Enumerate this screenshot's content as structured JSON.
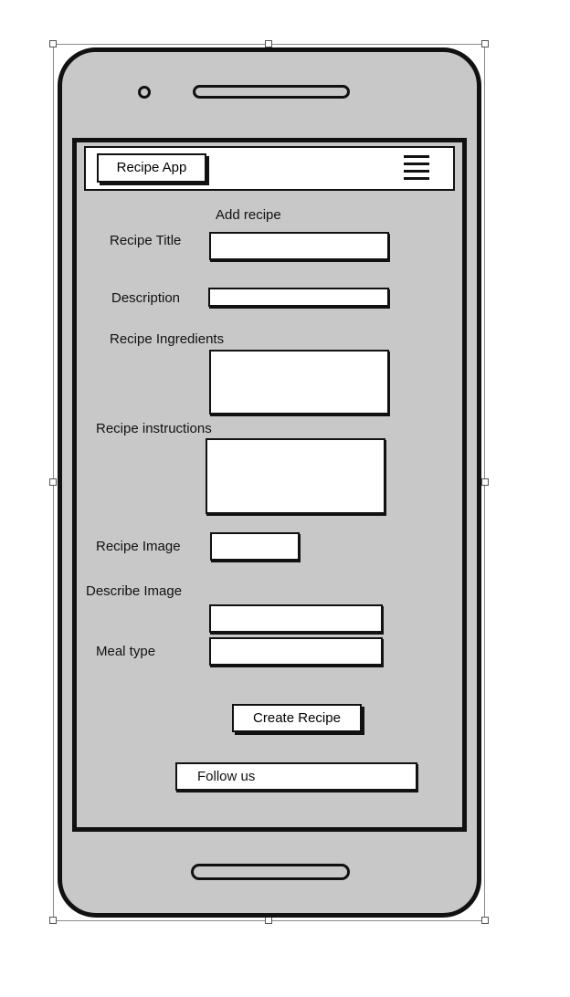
{
  "header": {
    "app_title": "Recipe App",
    "menu_icon": "hamburger-menu-icon"
  },
  "form": {
    "heading": "Add recipe",
    "fields": {
      "recipe_title": {
        "label": "Recipe Title",
        "value": ""
      },
      "description": {
        "label": "Description",
        "value": ""
      },
      "ingredients": {
        "label": "Recipe Ingredients",
        "value": ""
      },
      "instructions": {
        "label": "Recipe instructions",
        "value": ""
      },
      "image": {
        "label": "Recipe Image",
        "value": ""
      },
      "image_description": {
        "label": "Describe Image",
        "value": ""
      },
      "meal_type": {
        "label": "Meal type",
        "value": ""
      }
    },
    "submit_label": "Create Recipe"
  },
  "footer": {
    "follow_label": "Follow us"
  },
  "colors": {
    "screen_background": "#c8c8c8",
    "outline": "#111111",
    "field_background": "#ffffff"
  }
}
